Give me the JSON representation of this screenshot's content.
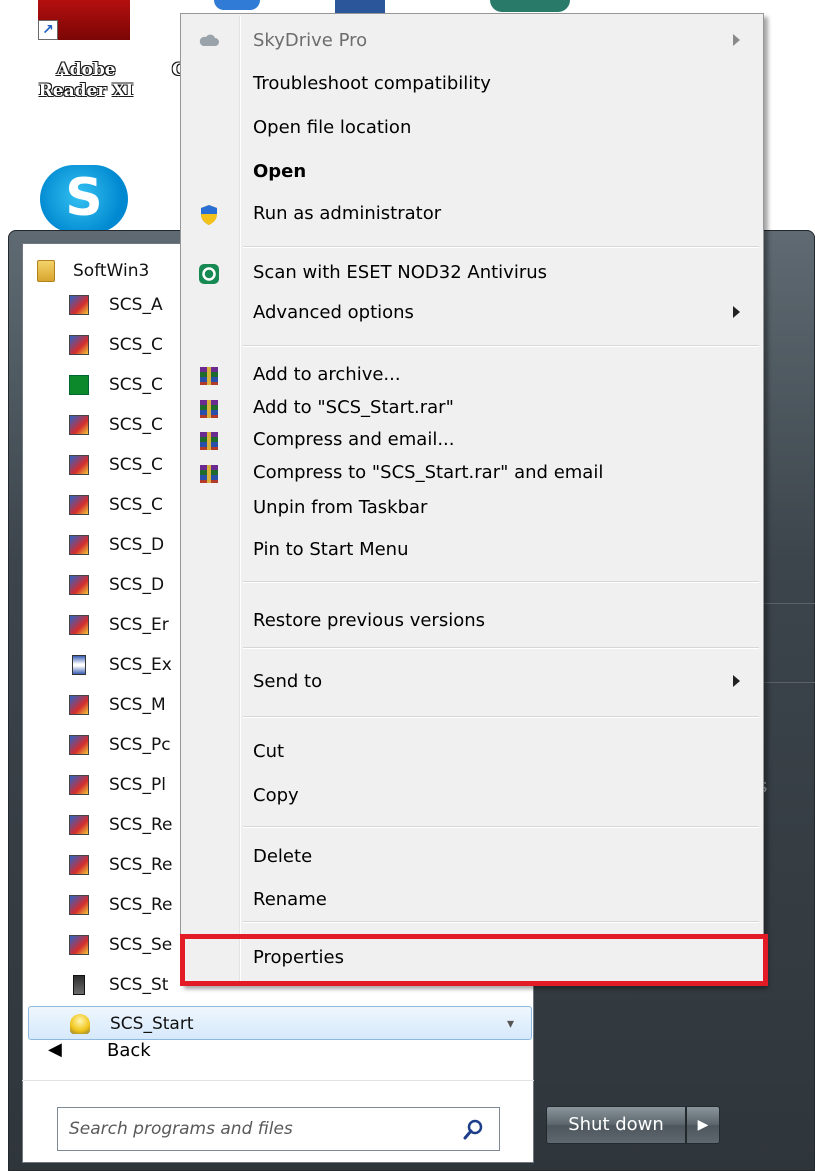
{
  "desktop": {
    "adobe_label_line1": "Adobe",
    "adobe_label_line2": "Reader XI"
  },
  "context_menu": {
    "items": [
      {
        "label": "SkyDrive Pro",
        "icon": "cloud-icon",
        "disabled": true,
        "submenu": true
      },
      {
        "label": "Troubleshoot compatibility"
      },
      {
        "label": "Open file location"
      },
      {
        "label": "Open",
        "bold": true
      },
      {
        "label": "Run as administrator",
        "icon": "uac-shield-icon"
      },
      {
        "label": "Scan with ESET NOD32 Antivirus",
        "icon": "eset-icon"
      },
      {
        "label": "Advanced options",
        "submenu": true
      },
      {
        "label": "Add to archive...",
        "icon": "winrar-icon"
      },
      {
        "label": "Add to \"SCS_Start.rar\"",
        "icon": "winrar-icon"
      },
      {
        "label": "Compress and email...",
        "icon": "winrar-icon"
      },
      {
        "label": "Compress to \"SCS_Start.rar\" and email",
        "icon": "winrar-icon"
      },
      {
        "label": "Unpin from Taskbar"
      },
      {
        "label": "Pin to Start Menu"
      },
      {
        "label": "Restore previous versions"
      },
      {
        "label": "Send to",
        "submenu": true
      },
      {
        "label": "Cut"
      },
      {
        "label": "Copy"
      },
      {
        "label": "Delete"
      },
      {
        "label": "Rename"
      },
      {
        "label": "Properties",
        "highlighted": true
      }
    ],
    "highlight_color": "#e21b27"
  },
  "start_menu": {
    "folder": {
      "label": "SoftWin3",
      "icon": "folder-icon"
    },
    "programs": [
      {
        "label": "SCS_A",
        "icon": "app-icon"
      },
      {
        "label": "SCS_C",
        "icon": "app-icon"
      },
      {
        "label": "SCS_C",
        "icon": "dollar-icon"
      },
      {
        "label": "SCS_C",
        "icon": "app-icon"
      },
      {
        "label": "SCS_C",
        "icon": "app-icon"
      },
      {
        "label": "SCS_C",
        "icon": "app-icon"
      },
      {
        "label": "SCS_D",
        "icon": "app-icon"
      },
      {
        "label": "SCS_D",
        "icon": "app-icon"
      },
      {
        "label": "SCS_Er",
        "icon": "app-icon"
      },
      {
        "label": "SCS_Ex",
        "icon": "hourglass-icon"
      },
      {
        "label": "SCS_M",
        "icon": "app-icon"
      },
      {
        "label": "SCS_Pc",
        "icon": "app-icon"
      },
      {
        "label": "SCS_Pl",
        "icon": "app-icon"
      },
      {
        "label": "SCS_Re",
        "icon": "app-icon"
      },
      {
        "label": "SCS_Re",
        "icon": "app-icon"
      },
      {
        "label": "SCS_Re",
        "icon": "app-icon"
      },
      {
        "label": "SCS_Se",
        "icon": "app-icon"
      },
      {
        "label": "SCS_St",
        "icon": "phone-icon"
      },
      {
        "label": "SCS_Start",
        "icon": "lightbulb-icon",
        "selected": true
      }
    ],
    "back_label": "Back",
    "search_placeholder": "Search programs and files",
    "shutdown_label": "Shut down"
  }
}
